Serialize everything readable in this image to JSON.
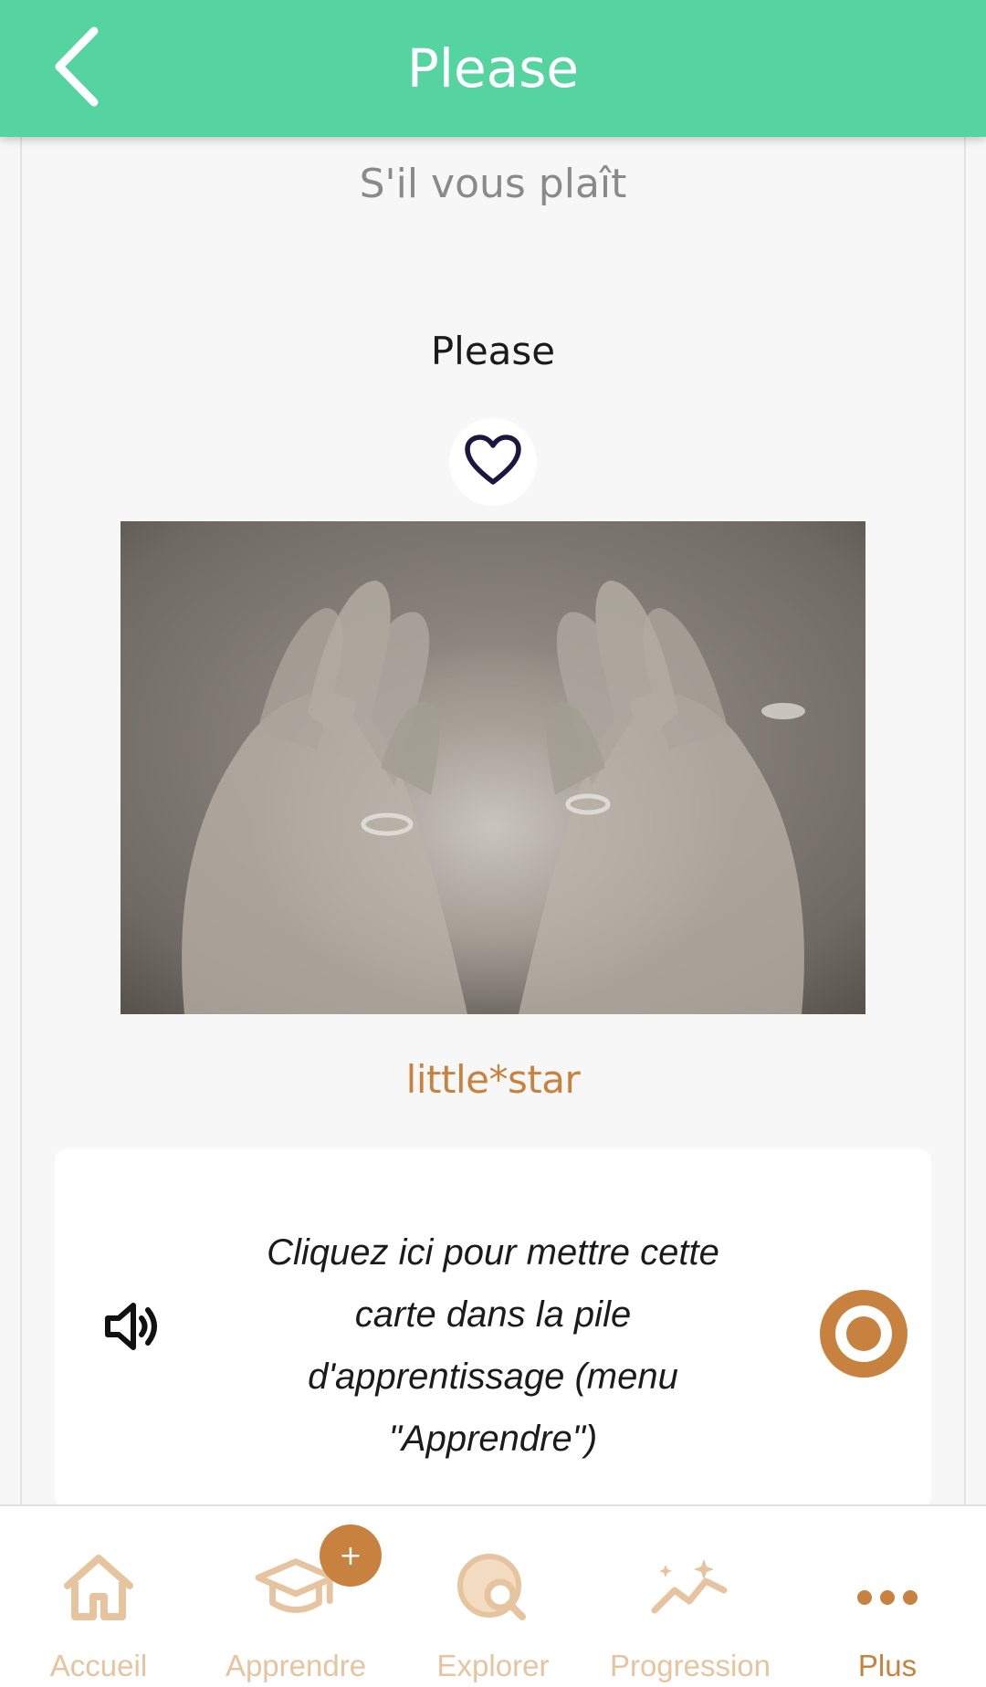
{
  "header": {
    "title": "Please",
    "back_icon": "chevron-left-icon"
  },
  "card": {
    "translation": "S'il vous plaît",
    "word": "Please",
    "favorite_icon": "heart-outline-icon",
    "image_description": "two cupped hands, palms up",
    "author": "little*star"
  },
  "action": {
    "text": "Cliquez ici pour mettre cette carte dans la pile d'apprentissage (menu \"Apprendre\")",
    "sound_icon": "speaker-icon",
    "record_icon": "record-icon"
  },
  "nav": {
    "items": [
      {
        "label": "Accueil",
        "icon": "home-icon"
      },
      {
        "label": "Apprendre",
        "icon": "graduation-cap-icon",
        "badge": "+"
      },
      {
        "label": "Explorer",
        "icon": "globe-search-icon"
      },
      {
        "label": "Progression",
        "icon": "trend-sparkle-icon"
      },
      {
        "label": "Plus",
        "icon": "more-dots-icon",
        "active": true
      }
    ]
  },
  "colors": {
    "header_bg": "#55d4a1",
    "accent": "#c8823f",
    "nav_inactive": "#e6c49f",
    "heart": "#1d1640"
  }
}
